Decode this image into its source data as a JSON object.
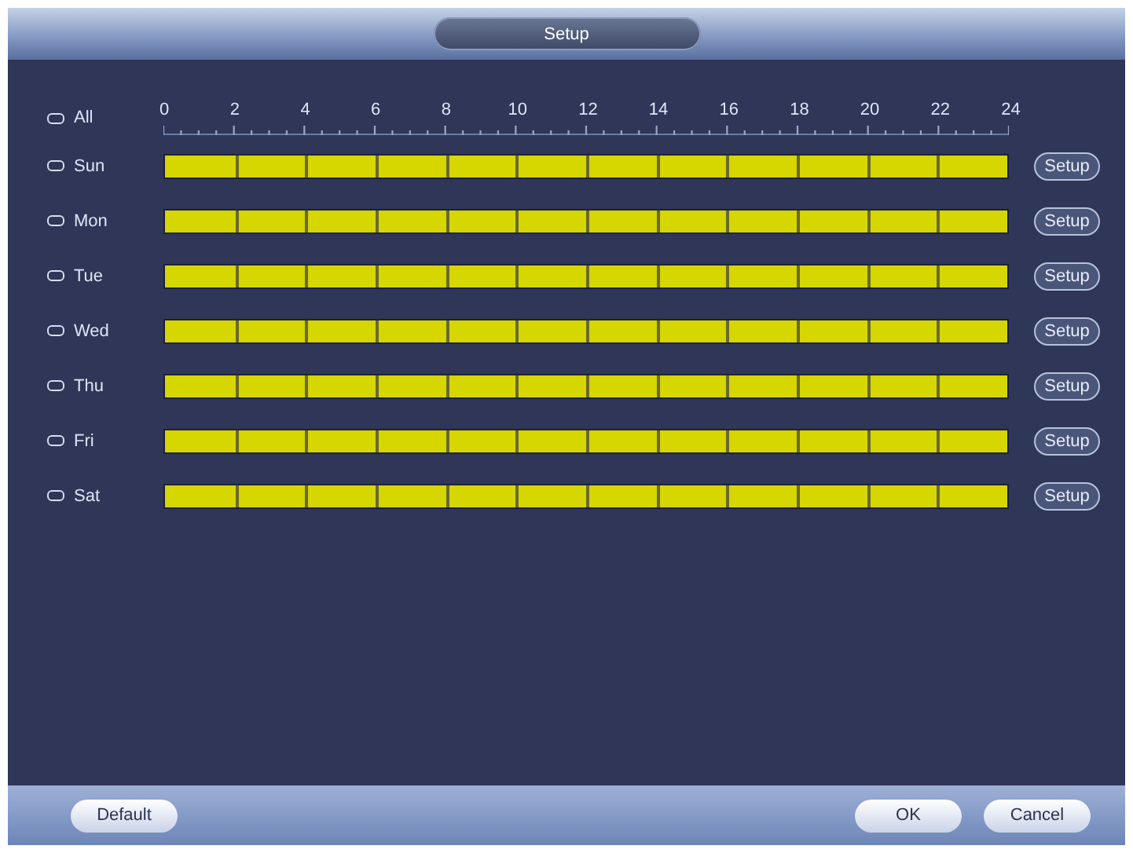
{
  "window": {
    "title": "Setup"
  },
  "all": {
    "label": "All",
    "checked": false
  },
  "axis": {
    "ticks": [
      "0",
      "2",
      "4",
      "6",
      "8",
      "10",
      "12",
      "14",
      "16",
      "18",
      "20",
      "22",
      "24"
    ]
  },
  "days": [
    {
      "label": "Sun",
      "checked": false,
      "level": 1,
      "button": "Setup"
    },
    {
      "label": "Mon",
      "checked": false,
      "level": 1,
      "button": "Setup"
    },
    {
      "label": "Tue",
      "checked": false,
      "level": 1,
      "button": "Setup"
    },
    {
      "label": "Wed",
      "checked": false,
      "level": 1,
      "button": "Setup"
    },
    {
      "label": "Thu",
      "checked": false,
      "level": 1,
      "button": "Setup"
    },
    {
      "label": "Fri",
      "checked": false,
      "level": 1,
      "button": "Setup"
    },
    {
      "label": "Sat",
      "checked": false,
      "level": 1,
      "button": "Setup"
    }
  ],
  "footer": {
    "left": [
      "Default"
    ],
    "right": [
      "OK",
      "Cancel"
    ]
  }
}
